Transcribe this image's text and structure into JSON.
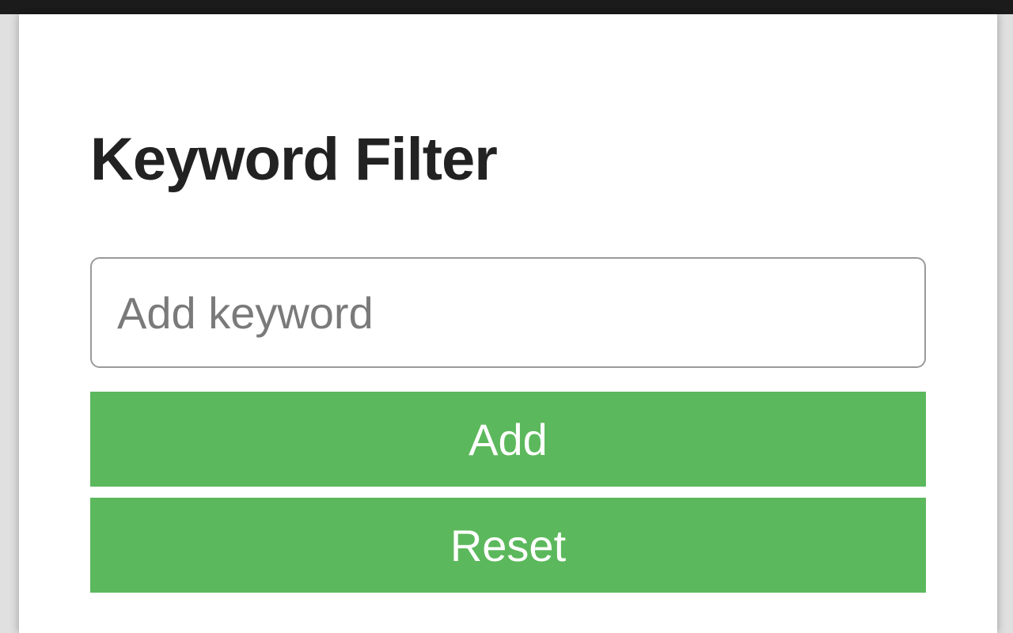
{
  "panel": {
    "title": "Keyword Filter",
    "input": {
      "placeholder": "Add keyword",
      "value": ""
    },
    "buttons": {
      "add": "Add",
      "reset": "Reset"
    }
  },
  "colors": {
    "button_bg": "#5cb85c",
    "button_text": "#ffffff",
    "border": "#9a9a9a"
  }
}
